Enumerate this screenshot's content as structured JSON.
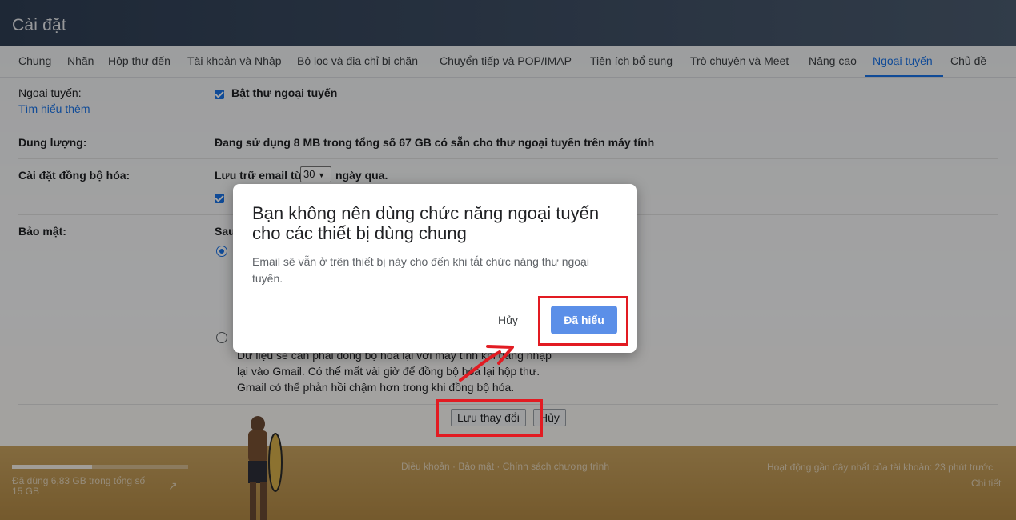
{
  "header": {
    "title": "Cài đặt"
  },
  "tabs": [
    {
      "label": "Chung"
    },
    {
      "label": "Nhãn"
    },
    {
      "label": "Hộp thư đến"
    },
    {
      "label": "Tài khoản và Nhập"
    },
    {
      "label": "Bộ lọc và địa chỉ bị chặn"
    },
    {
      "label": "Chuyển tiếp và POP/IMAP"
    },
    {
      "label": "Tiện ích bổ sung"
    },
    {
      "label": "Trò chuyện và Meet"
    },
    {
      "label": "Nâng cao"
    },
    {
      "label": "Ngoại tuyến"
    },
    {
      "label": "Chủ đề"
    }
  ],
  "offline": {
    "label": "Ngoại tuyến:",
    "learn_more": "Tìm hiểu thêm",
    "enable_checkbox_label": "Bật thư ngoại tuyến"
  },
  "storage": {
    "label": "Dung lượng:",
    "text": "Đang sử dụng 8 MB trong tổng số 67 GB có sẵn cho thư ngoại tuyến trên máy tính"
  },
  "sync": {
    "label": "Cài đặt đồng bộ hóa:",
    "prefix": "Lưu trữ email từ",
    "days_value": "30",
    "suffix": "ngày qua."
  },
  "security": {
    "label": "Bảo mật:",
    "partial_text": "Sau",
    "remove_desc_lines": [
      "Dữ liệu sẽ cần phải đồng bộ hóa lại với máy tính khi đăng nhập",
      "lại vào Gmail. Có thể mất vài giờ để đồng bộ hóa lại hộp thư.",
      "Gmail có thể phản hồi chậm hơn trong khi đồng bộ hóa."
    ]
  },
  "actions": {
    "save": "Lưu thay đổi",
    "cancel": "Hủy"
  },
  "footer": {
    "storage_text": "Đã dùng 6,83 GB trong tổng số 15 GB",
    "storage_fraction": 0.455,
    "links": "Điều khoản · Bảo mật · Chính sách chương trình",
    "activity": "Hoạt động gần đây nhất của tài khoản: 23 phút trước",
    "details": "Chi tiết"
  },
  "dialog": {
    "title": "Bạn không nên dùng chức năng ngoại tuyến cho các thiết bị dùng chung",
    "body": "Email sẽ vẫn ở trên thiết bị này cho đến khi tắt chức năng thư ngoại tuyến.",
    "cancel_label": "Hủy",
    "ok_label": "Đã hiểu"
  },
  "colors": {
    "accent": "#1a73e8",
    "highlight": "#e21b22",
    "ok_button": "#5b8fe8"
  }
}
